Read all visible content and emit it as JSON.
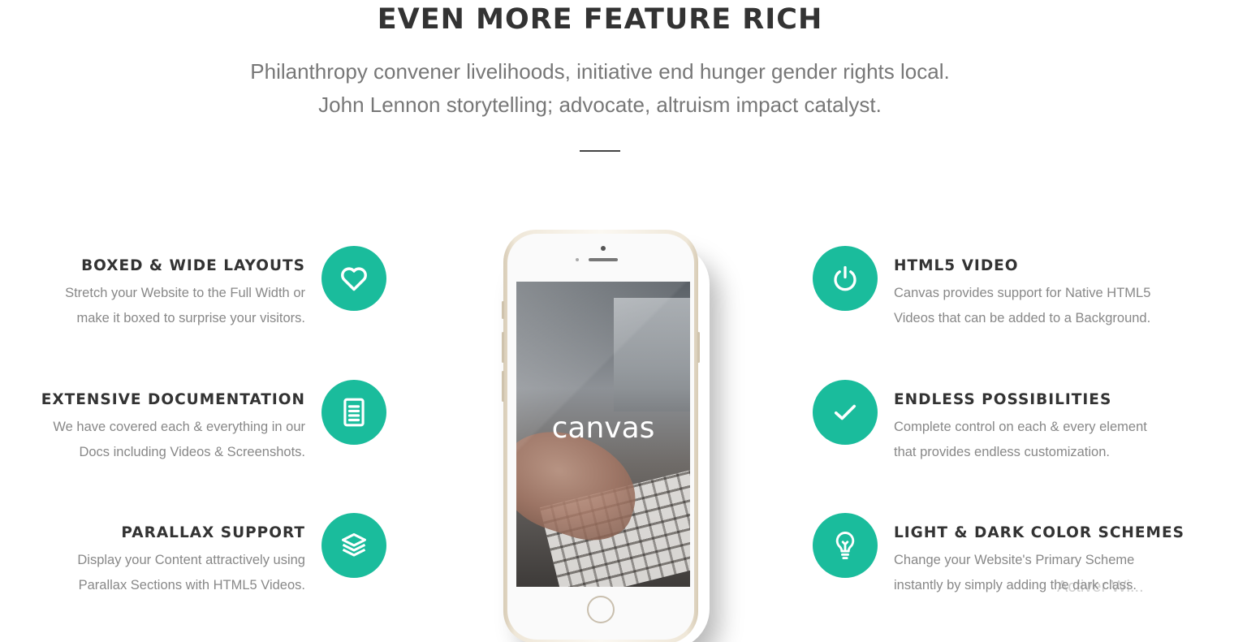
{
  "section": {
    "title": "EVEN MORE FEATURE RICH",
    "subtitle_line1": "Philanthropy convener livelihoods, initiative end hunger gender rights local.",
    "subtitle_line2": "John Lennon storytelling; advocate, altruism impact catalyst."
  },
  "colors": {
    "accent": "#1abc9c",
    "heading": "#333333",
    "text": "#888888"
  },
  "features_left": [
    {
      "title": "BOXED & WIDE LAYOUTS",
      "desc_line1": "Stretch your Website to the Full Width or",
      "desc_line2": "make it boxed to surprise your visitors.",
      "icon": "heart-icon"
    },
    {
      "title": "EXTENSIVE DOCUMENTATION",
      "desc_line1": "We have covered each & everything in our",
      "desc_line2": "Docs including Videos & Screenshots.",
      "icon": "document-icon"
    },
    {
      "title": "PARALLAX SUPPORT",
      "desc_line1": "Display your Content attractively using",
      "desc_line2": "Parallax Sections with HTML5 Videos.",
      "icon": "layers-icon"
    }
  ],
  "features_right": [
    {
      "title": "HTML5 VIDEO",
      "desc_line1": "Canvas provides support for Native HTML5",
      "desc_line2": "Videos that can be added to a Background.",
      "icon": "power-icon"
    },
    {
      "title": "ENDLESS POSSIBILITIES",
      "desc_line1": "Complete control on each & every element",
      "desc_line2": "that provides endless customization.",
      "icon": "check-icon"
    },
    {
      "title": "LIGHT & DARK COLOR SCHEMES",
      "desc_line1": "Change your Website's Primary Scheme",
      "desc_line2": "instantly by simply adding the dark class.",
      "icon": "lightbulb-icon"
    }
  ],
  "phone": {
    "screen_logo": "canvas"
  },
  "watermark": "Activer Wi..."
}
